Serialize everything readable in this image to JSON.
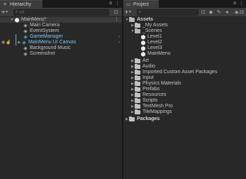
{
  "hierarchy": {
    "tab_label": "Hierarchy",
    "search_placeholder": "All",
    "items": [
      {
        "label": "MainMenu*",
        "kind": "scene"
      },
      {
        "label": "Main Camera",
        "kind": "gameobject"
      },
      {
        "label": "EventSystem",
        "kind": "gameobject"
      },
      {
        "label": "GameManager",
        "kind": "prefab"
      },
      {
        "label": "MainMenu UI Canvas",
        "kind": "prefab"
      },
      {
        "label": "Background Music",
        "kind": "gameobject"
      },
      {
        "label": "Screenshot",
        "kind": "gameobject"
      }
    ]
  },
  "project": {
    "tab_label": "Project",
    "visible_count": "22",
    "items": [
      {
        "label": "Assets",
        "kind": "folder-open",
        "bold": true
      },
      {
        "label": "_My Assets",
        "kind": "folder"
      },
      {
        "label": "_Scenes",
        "kind": "folder-open"
      },
      {
        "label": "Level1",
        "kind": "scene"
      },
      {
        "label": "Level2",
        "kind": "scene"
      },
      {
        "label": "Level3",
        "kind": "scene"
      },
      {
        "label": "MainMenu",
        "kind": "scene"
      },
      {
        "label": "Art",
        "kind": "folder"
      },
      {
        "label": "Audio",
        "kind": "folder"
      },
      {
        "label": "Imported Custom Asset Packages",
        "kind": "folder"
      },
      {
        "label": "Input",
        "kind": "folder"
      },
      {
        "label": "Physics Materials",
        "kind": "folder"
      },
      {
        "label": "Prefabs",
        "kind": "folder"
      },
      {
        "label": "Resources",
        "kind": "folder"
      },
      {
        "label": "Scripts",
        "kind": "folder"
      },
      {
        "label": "TextMesh Pro",
        "kind": "folder"
      },
      {
        "label": "TileMappings",
        "kind": "folder"
      },
      {
        "label": "Packages",
        "kind": "folder",
        "bold": true
      }
    ]
  },
  "colors": {
    "background": "#282828",
    "toolbar": "#3c3c3c",
    "prefab_blue": "#5fb3e8",
    "text": "#c4c4c4"
  }
}
